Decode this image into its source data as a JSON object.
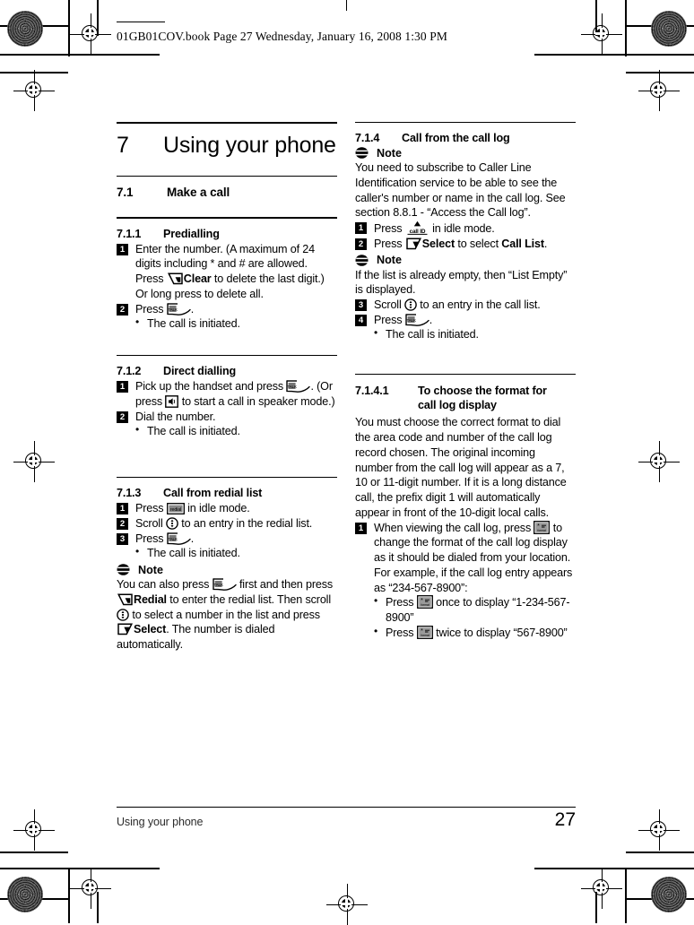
{
  "slug": "01GB01COV.book  Page 27  Wednesday, January 16, 2008  1:30 PM",
  "chapter": {
    "number": "7",
    "title": "Using your phone"
  },
  "sections": {
    "make_a_call": {
      "number": "7.1",
      "title": "Make a call"
    },
    "predialling": {
      "number": "7.1.1",
      "title": "Predialling"
    },
    "direct_dialling": {
      "number": "7.1.2",
      "title": "Direct dialling"
    },
    "redial_list": {
      "number": "7.1.3",
      "title": "Call from redial list"
    },
    "call_log": {
      "number": "7.1.4",
      "title": "Call from the call log"
    },
    "format_call_log": {
      "number": "7.1.4.1",
      "title_line1": "To choose the format for",
      "title_line2": "call log display"
    }
  },
  "note_label": "Note",
  "predialling": {
    "step1_a": "Enter the number. (A maximum of 24 digits including * and # are allowed. Press ",
    "step1_b": "Clear",
    "step1_c": " to delete the last digit.) Or long press to delete all.",
    "step2_a": "Press ",
    "step2_b": ".",
    "bullet1": "The call is initiated."
  },
  "direct_dialling": {
    "step1_a": "Pick up the handset and press ",
    "step1_b": ". (Or press ",
    "step1_c": " to start a call in speaker mode.)",
    "step2": "Dial the number.",
    "bullet1": "The call is initiated."
  },
  "redial_list": {
    "step1_a": "Press ",
    "step1_b": " in idle mode.",
    "step2_a": "Scroll ",
    "step2_b": " to an entry in the redial list.",
    "step3_a": "Press ",
    "step3_b": ".",
    "bullet1": "The call is initiated.",
    "note_a": "You can also press ",
    "note_b": " first and then press ",
    "note_c": "Redial",
    "note_d": " to enter the redial list. Then scroll ",
    "note_e": " to select a number in the list and press ",
    "note_f": "Select",
    "note_g": ". The number is dialed automatically."
  },
  "call_log": {
    "note1": "You need to subscribe to Caller Line Identification service to be able to see the caller's number or name in the call log. See section 8.8.1 - “Access the Call log”.",
    "step1_a": "Press ",
    "step1_b": " in idle mode.",
    "step2_a": "Press ",
    "step2_b": "Select",
    "step2_c": " to select ",
    "step2_d": "Call List",
    "step2_e": ".",
    "note2": "If the list is already empty, then “List Empty” is displayed.",
    "step3_a": "Scroll ",
    "step3_b": " to an entry in the call list.",
    "step4_a": "Press ",
    "step4_b": ".",
    "bullet1": "The call is initiated."
  },
  "format_call_log": {
    "intro": "You must choose the correct format to dial the area code and number of the call log record chosen. The original incoming number from the call log will appear as a 7, 10 or 11-digit number. If it is a long distance call, the prefix digit 1 will automatically appear in front of the 10-digit local calls.",
    "step1_a": "When viewing the call log, press ",
    "step1_b": " to change the format of the call log display as it should be dialed from your location. For example, if the call log entry appears as “234-567-8900”:",
    "bullet1_a": "Press ",
    "bullet1_b": " once to display “1-234-567-8900”",
    "bullet2_a": "Press ",
    "bullet2_b": " twice to display “567-8900”"
  },
  "steps": {
    "n1": "1",
    "n2": "2",
    "n3": "3",
    "n4": "4"
  },
  "keys": {
    "softkey_left": "left-soft-key",
    "softkey_right": "right-soft-key",
    "talk": "talk-key",
    "speaker": "speaker-key",
    "redial": "redial-key",
    "redial_label": "redial",
    "scroll": "navigation-key",
    "callid": "call-id-key",
    "callid_label": "call ID",
    "star": "star-format-key"
  },
  "footer": {
    "running_head": "Using your phone",
    "page_number": "27"
  },
  "colors": {
    "text": "#000000",
    "page_bg": "#ffffff",
    "rule": "#000000",
    "footer_text": "#2b2b2b"
  }
}
